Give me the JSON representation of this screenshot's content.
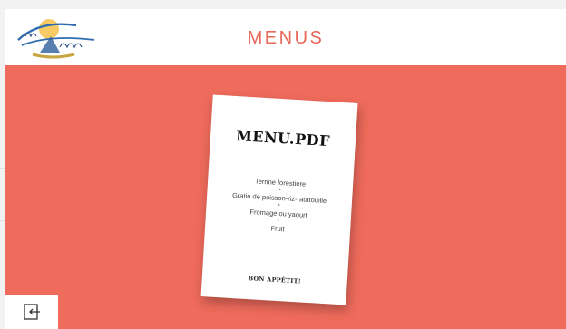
{
  "header": {
    "logo_alt": "La Maison de Rosenbach",
    "title": "MENUS"
  },
  "menu_card": {
    "title": "MENU.PDF",
    "items": [
      "Terrine forestière",
      "Gratin de poisson-riz-ratatouille",
      "Fromage ou yaourt",
      "Fruit"
    ],
    "separator": "•",
    "footer": "BON APPÉTIT!"
  },
  "corner_button": {
    "icon": "sign-in-icon"
  },
  "colors": {
    "accent": "#ef6b5c",
    "title": "#e8685a",
    "background": "#ffffff"
  }
}
